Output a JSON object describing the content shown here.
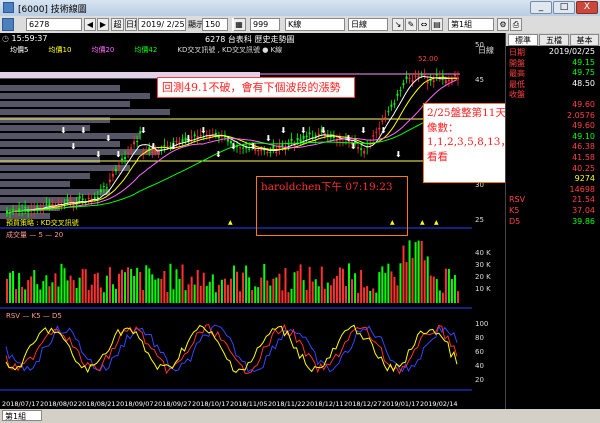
{
  "window": {
    "title": "[6000] 技術線圖",
    "min": "_",
    "max": "□",
    "close": "X"
  },
  "toolbar": {
    "stock_code": "6278",
    "btn_super": "超",
    "sel_date_label": "日期",
    "date": "2019/ 2/25",
    "display_label": "顯示",
    "display_count": "150",
    "btn_menu": "▦",
    "days": "999",
    "kline": "K線",
    "period": "日線",
    "layout": "第1組"
  },
  "chart": {
    "time": "15:59:37",
    "header_title": "6278 台表科  歷史走勢圖",
    "ma_legend": [
      "均價5",
      "均價10",
      "均價20",
      "均價42"
    ],
    "signal_legend": "KD交叉訊號 , KD交叉訊號 ● K線",
    "top_right": "日線",
    "price_hi_label": "52.00",
    "strategy_label": "預買策略 : KD交叉訊號",
    "volume_label": "成交量 — 5 — 20",
    "kd_label": "RSV — K5 — D5",
    "price_ticks": [
      "50",
      "45",
      "40",
      "35",
      "30",
      "25"
    ],
    "volume_ticks": [
      "40 K",
      "30 K",
      "20 K",
      "10 K"
    ],
    "kd_ticks": [
      "100",
      "80",
      "60",
      "40",
      "20"
    ],
    "dates": [
      "2018/07/17",
      "2018/08/02",
      "2018/08/21",
      "2018/09/07",
      "2018/09/27",
      "2018/10/17",
      "2018/11/05",
      "2018/11/22",
      "2018/12/11",
      "2018/12/27",
      "2019/01/17",
      "2019/02/14"
    ]
  },
  "annotations": {
    "box1": "回測49.1不破，會有下個波段的漲勢",
    "box2": "2/25盤整第11天，費波像數：1,1,2,3,5,8,13，參考看看",
    "box3": "haroldchen下午 07:19:23"
  },
  "sidebar": {
    "tabs": [
      "標準",
      "五檔",
      "基本"
    ],
    "rows": [
      {
        "k": "日期",
        "v": "2019/02/25",
        "c": "#ffffff"
      },
      {
        "k": "開盤",
        "v": "49.15",
        "c": "#00ff00"
      },
      {
        "k": "最高",
        "v": "49.75",
        "c": "#00ff00"
      },
      {
        "k": "最低",
        "v": "48.50",
        "c": "#ffffff"
      },
      {
        "k": "收盤",
        "v": "",
        "c": "#ffffff"
      },
      {
        "k": "",
        "v": "49.60",
        "c": "#ff4040"
      },
      {
        "k": "",
        "v": "2.0576",
        "c": "#ff4040"
      },
      {
        "k": "",
        "v": "49.60",
        "c": "#ff4040"
      },
      {
        "k": "",
        "v": "49.10",
        "c": "#00ff00"
      },
      {
        "k": "",
        "v": "46.38",
        "c": "#ff4040"
      },
      {
        "k": "",
        "v": "41.58",
        "c": "#ff4040"
      },
      {
        "k": "",
        "v": "40.25",
        "c": "#ff4040"
      },
      {
        "k": "",
        "v": "9274",
        "c": "#ffff00"
      },
      {
        "k": "",
        "v": "14698",
        "c": "#ff4040"
      },
      {
        "k": "RSV",
        "v": "21.54",
        "c": "#ff4040"
      },
      {
        "k": "K5",
        "v": "37.04",
        "c": "#ff4040"
      },
      {
        "k": "D5",
        "v": "39.86",
        "c": "#00ff00"
      }
    ]
  },
  "bottom": {
    "tab": "第1組"
  }
}
